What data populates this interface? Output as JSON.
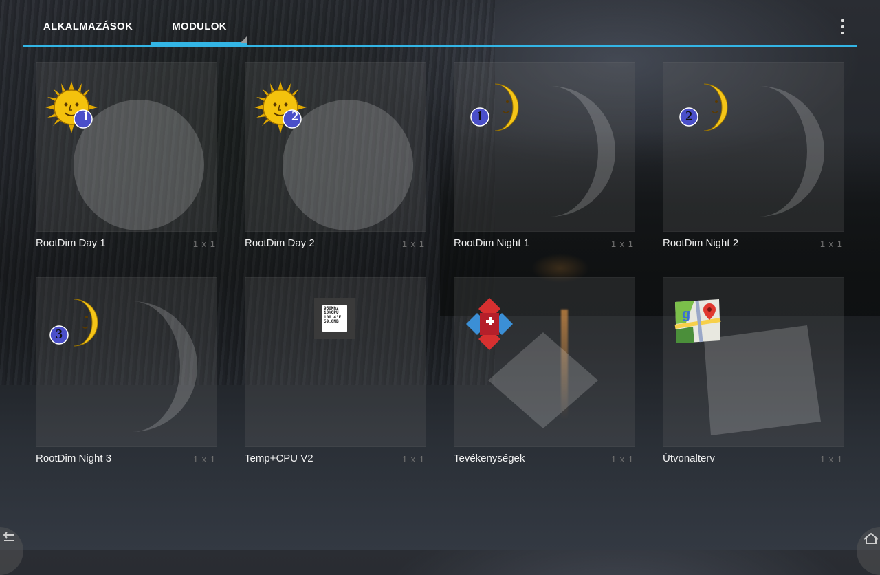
{
  "tabs": {
    "apps_label": "ALKALMAZÁSOK",
    "widgets_label": "MODULOK",
    "active": "widgets"
  },
  "overflow_menu_icon": "overflow-menu-icon",
  "widgets": [
    {
      "name": "RootDim Day 1",
      "size": "1 x 1",
      "icon": "sun-face-1-icon",
      "badge": "1"
    },
    {
      "name": "RootDim Day 2",
      "size": "1 x 1",
      "icon": "sun-face-2-icon",
      "badge": "2"
    },
    {
      "name": "RootDim Night 1",
      "size": "1 x 1",
      "icon": "moon-face-1-icon",
      "badge": "1"
    },
    {
      "name": "RootDim Night 2",
      "size": "1 x 1",
      "icon": "moon-face-2-icon",
      "badge": "2"
    },
    {
      "name": "RootDim Night 3",
      "size": "1 x 1",
      "icon": "moon-face-3-icon",
      "badge": "3"
    },
    {
      "name": "Temp+CPU V2",
      "size": "1 x 1",
      "icon": "temp-cpu-widget-icon",
      "readout": [
        "950Mhz",
        "10%CPU",
        "100.4°F",
        "59.0MB"
      ]
    },
    {
      "name": "Tevékenységek",
      "size": "1 x 1",
      "icon": "puzzle-cross-icon"
    },
    {
      "name": "Útvonalterv",
      "size": "1 x 1",
      "icon": "google-maps-icon"
    }
  ],
  "colors": {
    "accent": "#33b5e5",
    "sun": "#f4c20d",
    "moon": "#f5c518",
    "badge": "#4a4fc9"
  }
}
